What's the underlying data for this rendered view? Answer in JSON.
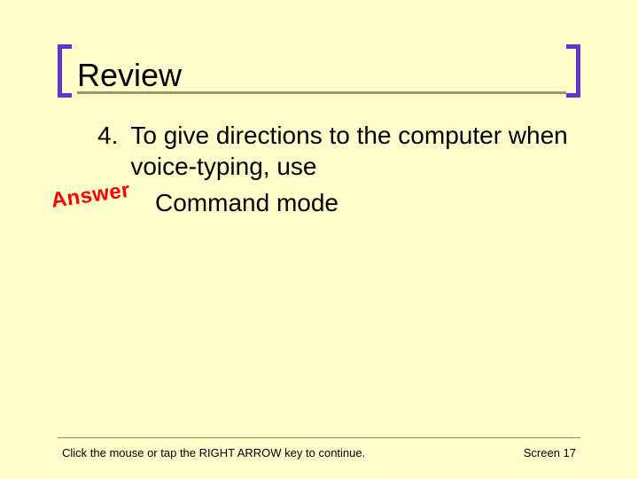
{
  "title": "Review",
  "question": {
    "number": "4.",
    "text": "To give directions to the computer when voice-typing, use"
  },
  "answer": {
    "label": "Answer",
    "text": "Command mode"
  },
  "footer": {
    "instruction": "Click the mouse or tap the RIGHT ARROW key to continue.",
    "screen": "Screen 17"
  }
}
